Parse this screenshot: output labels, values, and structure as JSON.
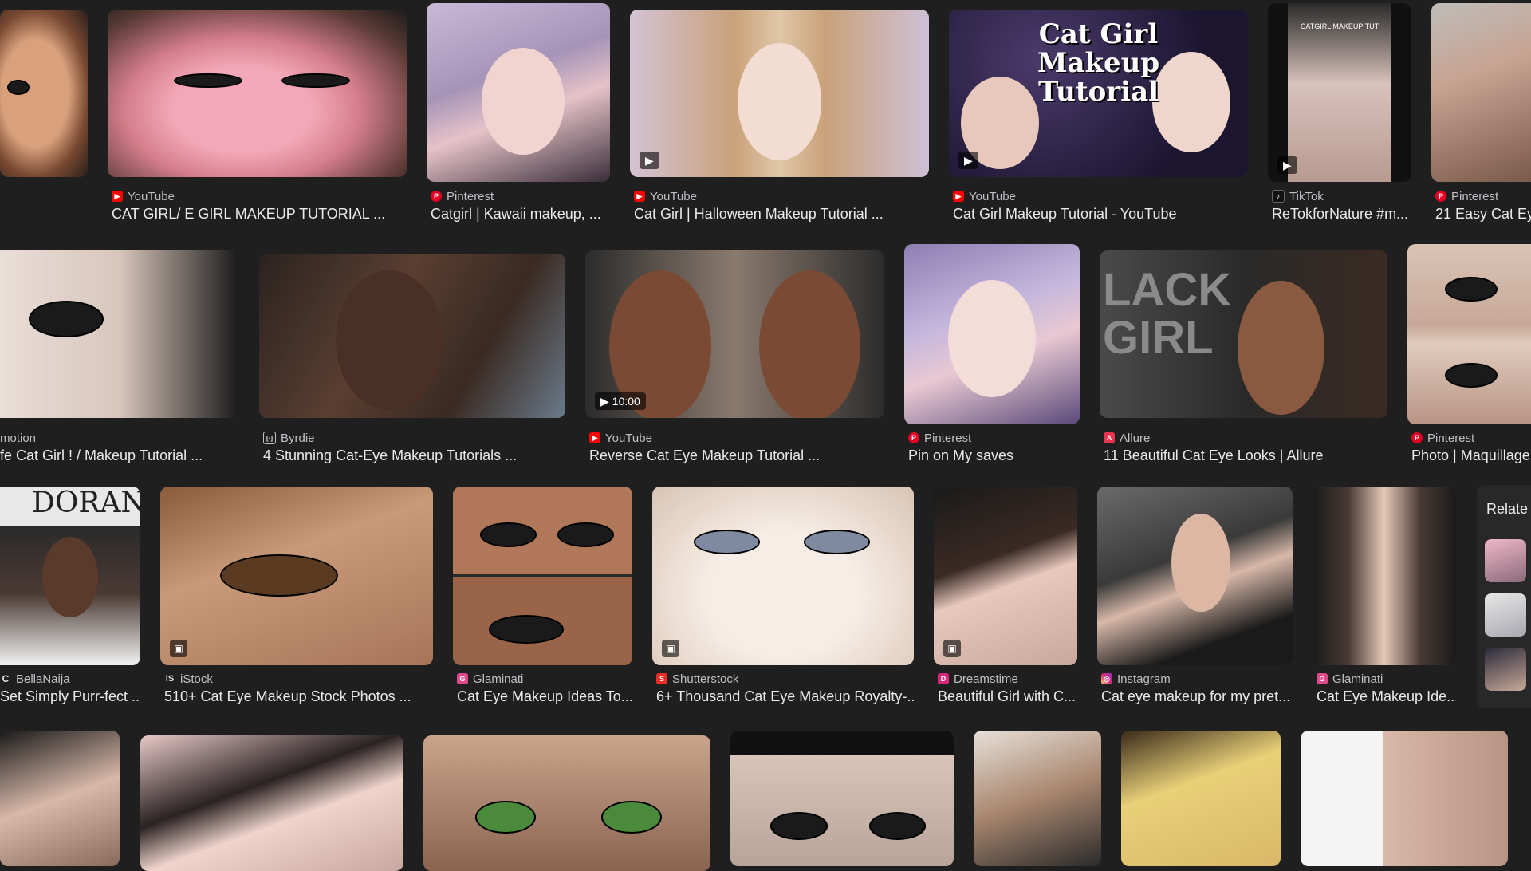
{
  "results": [
    {
      "source": "YouTube",
      "title": "CAT GIRL/ E GIRL MAKEUP TUTORIAL ...",
      "icon": "youtube-icon",
      "icon_color": "#ff0000",
      "badge": ""
    },
    {
      "source": "Pinterest",
      "title": "Catgirl | Kawaii makeup, ...",
      "icon": "pinterest-icon",
      "icon_color": "#e60023",
      "badge": ""
    },
    {
      "source": "YouTube",
      "title": "Cat Girl | Halloween Makeup Tutorial ...",
      "icon": "youtube-icon",
      "icon_color": "#ff0000",
      "badge": "play"
    },
    {
      "source": "YouTube",
      "title": "Cat Girl Makeup Tutorial - YouTube",
      "icon": "youtube-icon",
      "icon_color": "#ff0000",
      "badge": "play",
      "overlay": "Cat Girl Makeup Tutorial"
    },
    {
      "source": "TikTok",
      "title": "ReTokforNature #m...",
      "icon": "tiktok-icon",
      "icon_color": "#111111",
      "badge": "play",
      "overlay": "CATGIRL MAKEUP TUT"
    },
    {
      "source": "Pinterest",
      "title": "21 Easy Cat Ey",
      "icon": "pinterest-icon",
      "icon_color": "#e60023",
      "badge": ""
    },
    {
      "source": "motion",
      "title": "fe Cat Girl ! / Makeup Tutorial ...",
      "icon": "",
      "icon_color": "",
      "badge": ""
    },
    {
      "source": "Byrdie",
      "title": "4 Stunning Cat-Eye Makeup Tutorials ...",
      "icon": "byrdie-icon",
      "icon_color": "#ffffff",
      "badge": ""
    },
    {
      "source": "YouTube",
      "title": "Reverse Cat Eye Makeup Tutorial ...",
      "icon": "youtube-icon",
      "icon_color": "#ff0000",
      "badge": "duration",
      "duration": "10:00"
    },
    {
      "source": "Pinterest",
      "title": "Pin on My saves",
      "icon": "pinterest-icon",
      "icon_color": "#e60023",
      "badge": ""
    },
    {
      "source": "Allure",
      "title": "11 Beautiful Cat Eye Looks | Allure",
      "icon": "allure-icon",
      "icon_color": "#e8344e",
      "badge": "",
      "overlay": "LACK GIRL"
    },
    {
      "source": "Pinterest",
      "title": "Photo | Maquillage",
      "icon": "pinterest-icon",
      "icon_color": "#e60023",
      "badge": ""
    },
    {
      "source": "BellaNaija",
      "title": "Set Simply Purr-fect ...",
      "icon": "bellanaija-icon",
      "icon_color": "#ffffff",
      "badge": "",
      "overlay": "DORAN"
    },
    {
      "source": "iStock",
      "title": "510+ Cat Eye Makeup Stock Photos ...",
      "icon": "istock-icon",
      "icon_color": "#ffffff",
      "badge": "image"
    },
    {
      "source": "Glaminati",
      "title": "Cat Eye Makeup Ideas To...",
      "icon": "glaminati-icon",
      "icon_color": "#e0488b",
      "badge": ""
    },
    {
      "source": "Shutterstock",
      "title": "6+ Thousand Cat Eye Makeup Royalty-...",
      "icon": "shutterstock-icon",
      "icon_color": "#ee2b24",
      "badge": "image"
    },
    {
      "source": "Dreamstime",
      "title": "Beautiful Girl with C...",
      "icon": "dreamstime-icon",
      "icon_color": "#d9257a",
      "badge": "image"
    },
    {
      "source": "Instagram",
      "title": "Cat eye makeup for my pret...",
      "icon": "instagram-icon",
      "icon_color": "#c13584",
      "badge": ""
    },
    {
      "source": "Glaminati",
      "title": "Cat Eye Makeup Ide...",
      "icon": "glaminati-icon",
      "icon_color": "#e0488b",
      "badge": ""
    }
  ],
  "related": {
    "label": "Relate"
  }
}
